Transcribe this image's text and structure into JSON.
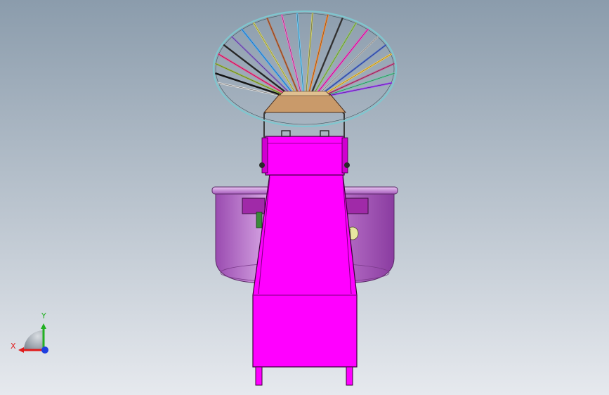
{
  "viewport": {
    "background_top": "#8b9cac",
    "background_bottom": "#e6e9ee"
  },
  "model": {
    "body_color": "#ff00ff",
    "bowl_color": "#c479d6",
    "hopper_rim_color": "#7fc7cf",
    "hopper_base_color": "#c99a6a",
    "rib_colors": [
      "#e0e0e0",
      "#111111",
      "#a0c040",
      "#ff3b8a",
      "#2a2a2a",
      "#8a6ad0",
      "#40a8ff",
      "#d8d86a",
      "#c86a3a",
      "#ff6ad0",
      "#6ad0ff",
      "#cfcf6a",
      "#ff8a2a",
      "#3a3a3a",
      "#9ad060",
      "#ff3bc8",
      "#bfbfbf",
      "#4a6ad0",
      "#ffd04a",
      "#d04a8a",
      "#60d0a0",
      "#a040ff"
    ]
  },
  "triad": {
    "x_label": "X",
    "y_label": "Y",
    "x_color": "#e01b1b",
    "y_color": "#22b022",
    "z_color": "#1f3fe0"
  }
}
